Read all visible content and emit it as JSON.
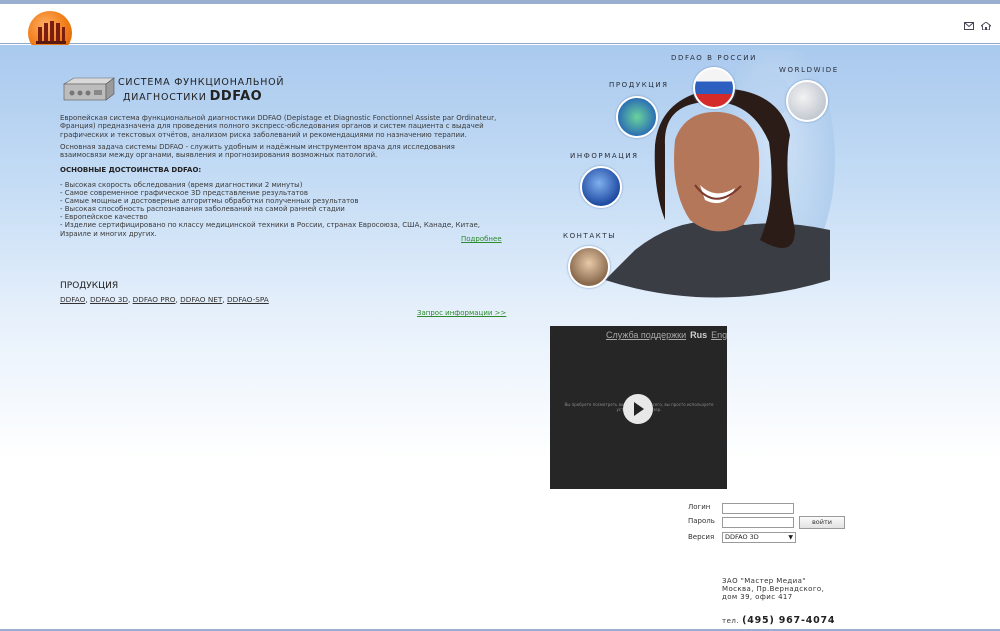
{
  "header": {
    "logo": "company-logo",
    "icons": [
      "mail-icon",
      "home-icon"
    ]
  },
  "system": {
    "title_line1": "СИСТЕМА ФУНКЦИОНАЛЬНОЙ",
    "title_line2": "ДИАГНОСТИКИ",
    "title_brand": "DDFAO",
    "intro": "Европейская система функциональной диагностики DDFAO (Depistage et Diagnostic Fonctionnel Assiste par Ordinateur, Франция) предназначена для проведения полного экспресс-обследования органов и систем пациента с выдачей графических и текстовых отчётов, анализом риска заболеваний и рекомендациями по назначению терапии.",
    "task": "Основная задача системы DDFAO - служить удобным и надёжным инструментом врача для исследования взаимосвязи между органами, выявления и прогнозирования возможных патологий.",
    "advantages_heading": "ОСНОВНЫЕ ДОСТОИНСТВА DDFAO:",
    "advantages": [
      "- Высокая скорость обследования (время диагностики 2 минуты)",
      "- Самое современное графическое 3D представление результатов",
      "- Самые мощные и достоверные алгоритмы обработки полученных результатов",
      "- Высокая способность распознавания заболеваний на самой ранней стадии",
      "- Европейское качество",
      "- Изделие сертифицировано по классу медицинской техники в России, странах Евросоюза, США, Канаде, Китае, Израиле и многих других."
    ],
    "more_link": "Подробнее"
  },
  "products": {
    "heading": "ПРОДУКЦИЯ",
    "items": [
      "DDFAO",
      "DDFAO 3D",
      "DDFAO PRO",
      "DDFAO NET",
      "DDFAO-SPA"
    ],
    "separator": ", ",
    "request_link": "Запрос информации >>"
  },
  "nav": {
    "russia": "DDFAO В РОССИИ",
    "worldwide": "WORLDWIDE",
    "products": "ПРОДУКЦИЯ",
    "info": "ИНФОРМАЦИЯ",
    "contacts": "КОНТАКТЫ"
  },
  "video": {
    "support": "Служба поддержки",
    "lang_ru": "Rus",
    "lang_en": "Eng",
    "message": "Вы пробуете посмотреть видео. Скорее всего, вы просто используете устаревший браузер."
  },
  "login": {
    "login_label": "Логин",
    "password_label": "Пароль",
    "version_label": "Версия",
    "login_value": "",
    "password_value": "",
    "version_selected": "DDFAO 3D",
    "submit_label": "войти"
  },
  "footer": {
    "company": "ЗАО \"Мастер Медиа\"",
    "address_line1": "Москва, Пр.Вернадского,",
    "address_line2": "дом 39, офис 417",
    "phone_label": "тел.",
    "phone": "(495) 967-4074"
  }
}
